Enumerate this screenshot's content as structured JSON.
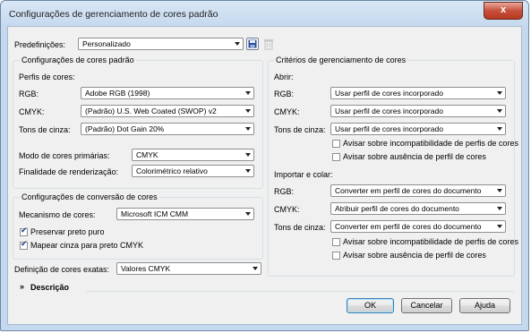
{
  "window": {
    "title": "Configurações de gerenciamento de cores padrão",
    "close_label": "x"
  },
  "presets": {
    "label": "Predefinições:",
    "value": "Personalizado"
  },
  "default_settings": {
    "title": "Configurações de cores padrão",
    "profiles_heading": "Perfis de cores:",
    "rgb": {
      "label": "RGB:",
      "value": "Adobe RGB (1998)"
    },
    "cmyk": {
      "label": "CMYK:",
      "value": "(Padrão) U.S. Web Coated (SWOP) v2"
    },
    "gray": {
      "label": "Tons de cinza:",
      "value": "(Padrão) Dot Gain 20%"
    },
    "primary_mode": {
      "label": "Modo de cores primárias:",
      "value": "CMYK"
    },
    "rendering_intent": {
      "label": "Finalidade de renderização:",
      "value": "Colorimétrico relativo"
    }
  },
  "conversion": {
    "title": "Configurações de conversão de cores",
    "engine": {
      "label": "Mecanismo de cores:",
      "value": "Microsoft ICM CMM"
    },
    "preserve_black": {
      "label": "Preservar preto puro",
      "checked": true
    },
    "map_gray": {
      "label": "Mapear cinza para preto CMYK",
      "checked": true
    }
  },
  "exact_colors": {
    "label": "Definição de cores exatas:",
    "value": "Valores CMYK"
  },
  "policies": {
    "title": "Critérios de gerenciamento de cores",
    "open": {
      "heading": "Abrir:",
      "rgb": {
        "label": "RGB:",
        "value": "Usar perfil de cores incorporado"
      },
      "cmyk": {
        "label": "CMYK:",
        "value": "Usar perfil de cores incorporado"
      },
      "gray": {
        "label": "Tons de cinza:",
        "value": "Usar perfil de cores incorporado"
      },
      "warn_mismatch": {
        "label": "Avisar sobre incompatibilidade de perfis de cores",
        "checked": false
      },
      "warn_missing": {
        "label": "Avisar sobre ausência de perfil de cores",
        "checked": false
      }
    },
    "import": {
      "heading": "Importar e colar:",
      "rgb": {
        "label": "RGB:",
        "value": "Converter em perfil de cores do documento"
      },
      "cmyk": {
        "label": "CMYK:",
        "value": "Atribuir perfil de cores do documento"
      },
      "gray": {
        "label": "Tons de cinza:",
        "value": "Converter em perfil de cores do documento"
      },
      "warn_mismatch": {
        "label": "Avisar sobre incompatibilidade de perfis de cores",
        "checked": false
      },
      "warn_missing": {
        "label": "Avisar sobre ausência de perfil de cores",
        "checked": false
      }
    }
  },
  "description": {
    "label": "Descrição"
  },
  "buttons": {
    "ok": "OK",
    "cancel": "Cancelar",
    "help": "Ajuda"
  }
}
